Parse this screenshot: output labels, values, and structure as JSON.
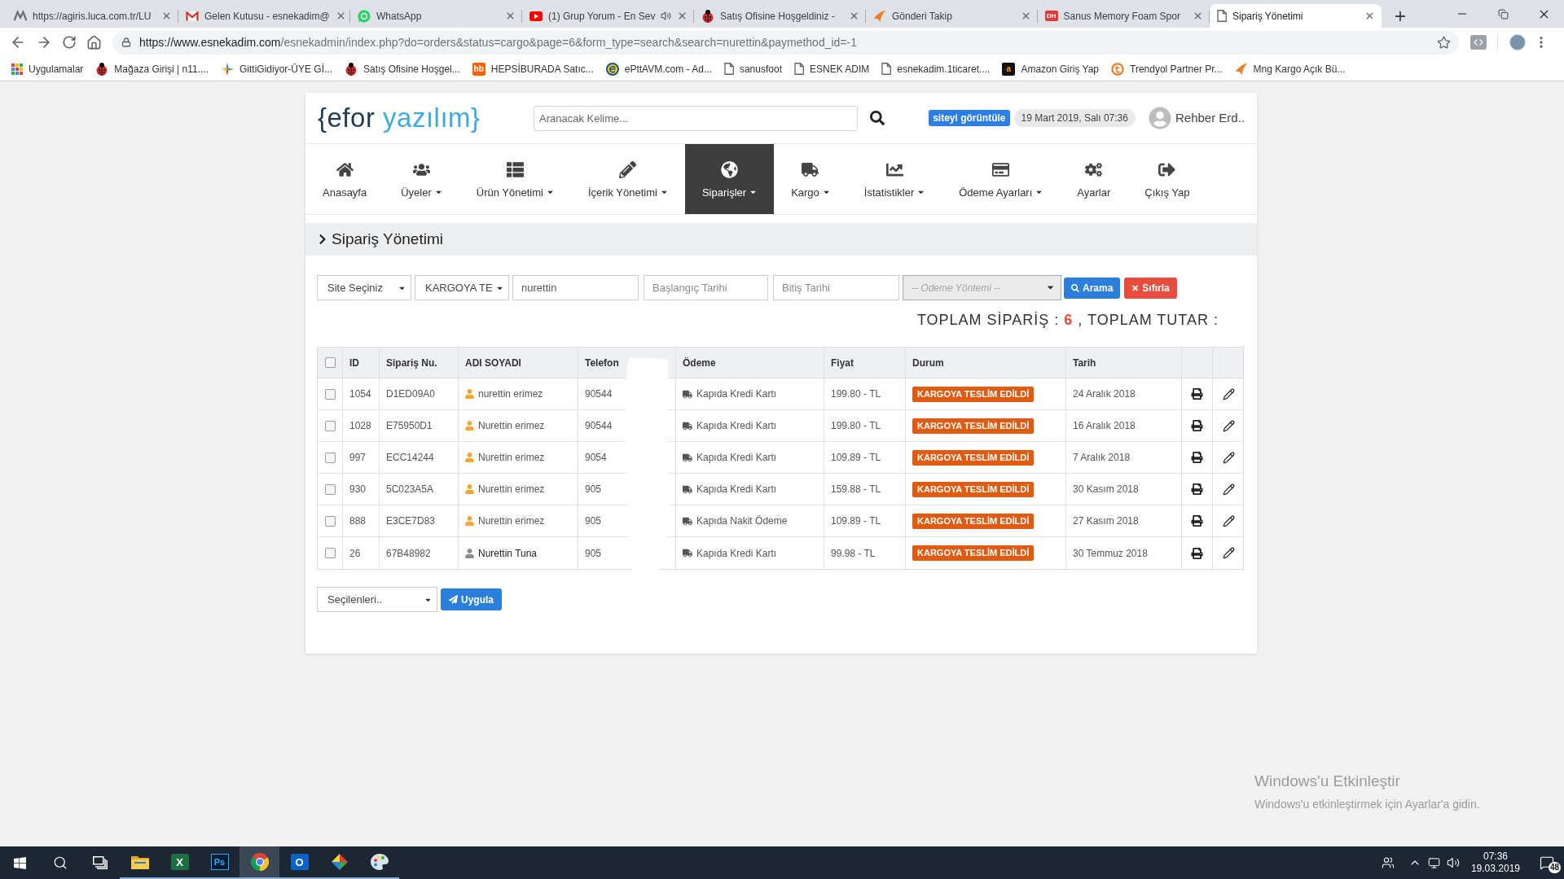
{
  "browser": {
    "tabs": [
      {
        "title": "https://agiris.luca.com.tr/LU",
        "selected": false,
        "audio": false
      },
      {
        "title": "Gelen Kutusu - esnekadim@",
        "selected": false,
        "audio": false
      },
      {
        "title": "WhatsApp",
        "selected": false,
        "audio": false
      },
      {
        "title": "(1) Grup Yorum - En Sev",
        "selected": false,
        "audio": true
      },
      {
        "title": "Satış Ofisine Hoşgeldiniz -",
        "selected": false,
        "audio": false
      },
      {
        "title": "Gönderi Takip",
        "selected": false,
        "audio": false
      },
      {
        "title": "Sanus Memory Foam Spor",
        "selected": false,
        "audio": false,
        "favicon_text": "DH"
      },
      {
        "title": "Sipariş Yönetimi",
        "selected": true,
        "audio": false
      }
    ],
    "address": {
      "host": "https://www.esnekadim.com",
      "path": "/esnekadmin/index.php?do=orders&status=cargo&page=6&form_type=search&search=nurettin&paymethod_id=-1"
    },
    "bookmarks": [
      {
        "label": "Uygulamalar"
      },
      {
        "label": "Mağaza Girişi | n11...."
      },
      {
        "label": "GittiGidiyor-ÜYE Gİ..."
      },
      {
        "label": "Satış Ofisine Hoşgel..."
      },
      {
        "label": "HEPSİBURADA Satıc...",
        "favicon_text": "hb"
      },
      {
        "label": "ePttAVM.com - Ad..."
      },
      {
        "label": "sanusfoot"
      },
      {
        "label": "ESNEK ADIM"
      },
      {
        "label": "esnekadim.1ticaret...."
      },
      {
        "label": "Amazon Giriş Yap",
        "favicon_text": "a"
      },
      {
        "label": "Trendyol Partner Pr..."
      },
      {
        "label": "Mng Kargo Açık Bü..."
      }
    ]
  },
  "header": {
    "logo": {
      "dark": "{efor",
      "light": "yazılım}"
    },
    "search": {
      "placeholder": "Aranacak Kelime..."
    },
    "site_link": "siteyi görüntüle",
    "datetime": "19 Mart 2019, Salı 07:36",
    "user": "Rehber Erd.."
  },
  "nav": [
    {
      "label": "Anasayfa",
      "has_menu": false,
      "selected": false
    },
    {
      "label": "Üyeler",
      "has_menu": true,
      "selected": false
    },
    {
      "label": "Ürün Yönetimi",
      "has_menu": true,
      "selected": false
    },
    {
      "label": "İçerik Yönetimi",
      "has_menu": true,
      "selected": false
    },
    {
      "label": "Siparişler",
      "has_menu": true,
      "selected": true
    },
    {
      "label": "Kargo",
      "has_menu": true,
      "selected": false
    },
    {
      "label": "İstatistikler",
      "has_menu": true,
      "selected": false
    },
    {
      "label": "Ödeme Ayarları",
      "has_menu": true,
      "selected": false
    },
    {
      "label": "Ayarlar",
      "has_menu": false,
      "selected": false
    },
    {
      "label": "Çıkış Yap",
      "has_menu": false,
      "selected": false
    }
  ],
  "page_title": "Sipariş Yönetimi",
  "filters": {
    "site": "Site Seçiniz",
    "status": "KARGOYA TE",
    "search": {
      "value": "nurettin"
    },
    "start_date": {
      "placeholder": "Başlangıç Tarihi"
    },
    "end_date": {
      "placeholder": "Bitiş Tarihi"
    },
    "payment_method": {
      "placeholder": "-- Odeme Yöntemi --"
    },
    "buttons": [
      {
        "label": "Arama",
        "kind": "search"
      },
      {
        "label": "Sıfırla",
        "kind": "reset"
      }
    ]
  },
  "totals": {
    "orders_label": "TOPLAM SİPARİŞ :",
    "orders_count": "6",
    "amount_label": ", TOPLAM TUTAR :"
  },
  "table": {
    "select_all": {
      "checked": false
    },
    "columns": [
      "ID",
      "Sipariş Nu.",
      "ADI SOYADI",
      "Telefon",
      "Ödeme",
      "Fiyat",
      "Durum",
      "Tarih"
    ],
    "rows": [
      {
        "checked": false,
        "id": "1054",
        "order_no": "D1ED09A0",
        "customer": {
          "name": "nurettin erimez",
          "kind": "member"
        },
        "phone": "90544",
        "payment": "Kapıda Kredi Kartı",
        "price": "199.80 - TL",
        "status": "KARGOYA TESLİM EDİLDİ",
        "date": "24 Aralık 2018"
      },
      {
        "checked": false,
        "id": "1028",
        "order_no": "E75950D1",
        "customer": {
          "name": "Nurettin erimez",
          "kind": "member"
        },
        "phone": "90544",
        "payment": "Kapıda Kredi Kartı",
        "price": "199.80 - TL",
        "status": "KARGOYA TESLİM EDİLDİ",
        "date": "16 Aralık 2018"
      },
      {
        "checked": false,
        "id": "997",
        "order_no": "ECC14244",
        "customer": {
          "name": "Nurettin erimez",
          "kind": "member"
        },
        "phone": "9054",
        "payment": "Kapıda Kredi Kartı",
        "price": "109.89 - TL",
        "status": "KARGOYA TESLİM EDİLDİ",
        "date": "7 Aralık 2018"
      },
      {
        "checked": false,
        "id": "930",
        "order_no": "5C023A5A",
        "customer": {
          "name": "Nurettin erimez",
          "kind": "member"
        },
        "phone": "905",
        "payment": "Kapıda Kredi Kartı",
        "price": "159.88 - TL",
        "status": "KARGOYA TESLİM EDİLDİ",
        "date": "30 Kasım 2018"
      },
      {
        "checked": false,
        "id": "888",
        "order_no": "E3CE7D83",
        "customer": {
          "name": "Nurettin erimez",
          "kind": "member"
        },
        "phone": "905",
        "payment": "Kapıda Nakit Ödeme",
        "price": "109.89 - TL",
        "status": "KARGOYA TESLİM EDİLDİ",
        "date": "27 Kasım 2018"
      },
      {
        "checked": false,
        "id": "26",
        "order_no": "67B48982",
        "customer": {
          "name": "Nurettin Tuna",
          "kind": "guest"
        },
        "phone": "905",
        "payment": "Kapıda Kredi Kartı",
        "price": "99.98 - TL",
        "status": "KARGOYA TESLİM EDİLDİ",
        "date": "30 Temmuz 2018"
      }
    ]
  },
  "bulk_action": {
    "select": "Seçilenleri..",
    "button": "Uygula"
  },
  "windows_notice": {
    "title": "Windows'u Etkinleştir",
    "text": "Windows'u etkinleştirmek için Ayarlar'a gidin."
  },
  "taskbar": {
    "apps": [
      {
        "selected": false
      },
      {
        "badge": "X",
        "selected": false
      },
      {
        "badge": "Ps",
        "selected": false
      },
      {
        "selected": true
      },
      {
        "badge": "O",
        "selected": false
      },
      {
        "selected": false
      },
      {
        "selected": false
      }
    ],
    "time": "07:36",
    "date": "19.03.2019",
    "notifications": "48"
  }
}
